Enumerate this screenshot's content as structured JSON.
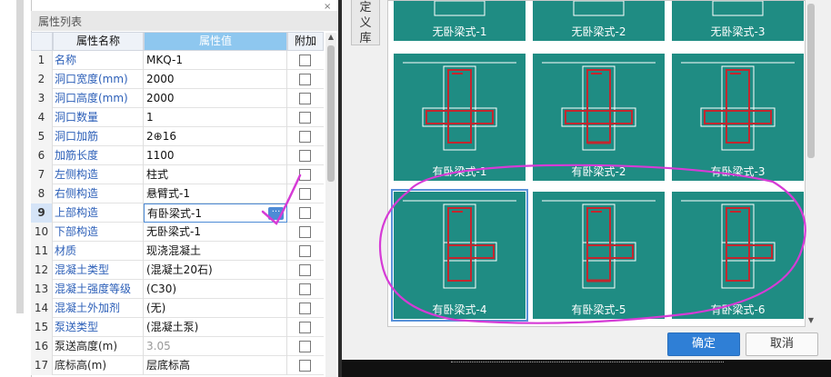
{
  "panel": {
    "title": "属性列表",
    "close_icon": "×",
    "headers": {
      "num": "",
      "name": "属性名称",
      "value": "属性值",
      "extra": "附加"
    }
  },
  "rows": [
    {
      "num": "1",
      "name": "名称",
      "value": "MKQ-1",
      "link": true
    },
    {
      "num": "2",
      "name": "洞口宽度(mm)",
      "value": "2000",
      "link": true
    },
    {
      "num": "3",
      "name": "洞口高度(mm)",
      "value": "2000",
      "link": true
    },
    {
      "num": "4",
      "name": "洞口数量",
      "value": "1",
      "link": true
    },
    {
      "num": "5",
      "name": "洞口加筋",
      "value": "2⊕16",
      "link": true
    },
    {
      "num": "6",
      "name": "加筋长度",
      "value": "1100",
      "link": true
    },
    {
      "num": "7",
      "name": "左侧构造",
      "value": "柱式",
      "link": true
    },
    {
      "num": "8",
      "name": "右侧构造",
      "value": "悬臂式-1",
      "link": true
    },
    {
      "num": "9",
      "name": "上部构造",
      "value": "有卧梁式-1",
      "link": true
    },
    {
      "num": "10",
      "name": "下部构造",
      "value": "无卧梁式-1",
      "link": true
    },
    {
      "num": "11",
      "name": "材质",
      "value": "现浇混凝土",
      "link": true
    },
    {
      "num": "12",
      "name": "混凝土类型",
      "value": "(混凝土20石)",
      "link": true
    },
    {
      "num": "13",
      "name": "混凝土强度等级",
      "value": "(C30)",
      "link": true
    },
    {
      "num": "14",
      "name": "混凝土外加剂",
      "value": "(无)",
      "link": true
    },
    {
      "num": "15",
      "name": "泵送类型",
      "value": "(混凝土泵)",
      "link": true
    },
    {
      "num": "16",
      "name": "泵送高度(m)",
      "value": "3.05",
      "link": false
    },
    {
      "num": "17",
      "name": "底标高(m)",
      "value": "层底标高",
      "link": false
    }
  ],
  "selected_row_dots": "···",
  "side_tab": {
    "line1": "定",
    "line2": "义",
    "line3": "库"
  },
  "tiles": [
    {
      "caption": "无卧梁式-1"
    },
    {
      "caption": "无卧梁式-2"
    },
    {
      "caption": "无卧梁式-3"
    },
    {
      "caption": "有卧梁式-1"
    },
    {
      "caption": "有卧梁式-2"
    },
    {
      "caption": "有卧梁式-3"
    },
    {
      "caption": "有卧梁式-4"
    },
    {
      "caption": "有卧梁式-5"
    },
    {
      "caption": "有卧梁式-6"
    }
  ],
  "buttons": {
    "ok": "确定",
    "cancel": "取消"
  },
  "colors": {
    "tile_bg": "#1f8c83",
    "rebar": "#c4262e",
    "annotation": "#d63bd6",
    "accent": "#2f7fd6"
  }
}
